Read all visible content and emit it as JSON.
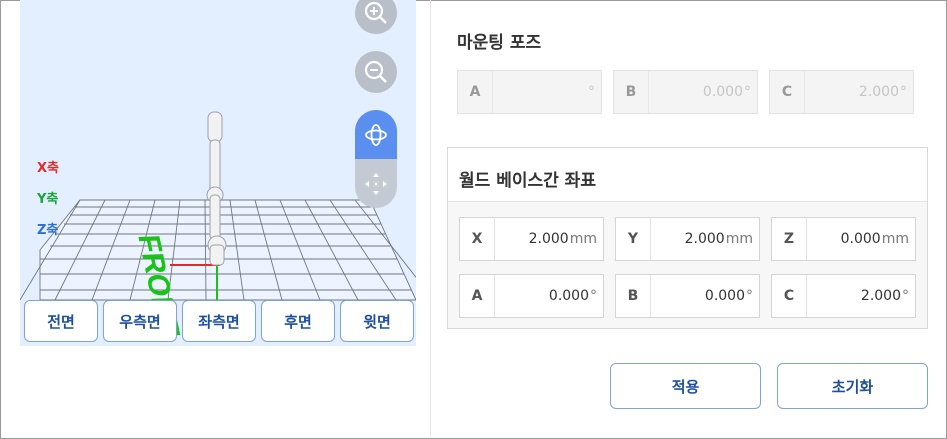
{
  "viewport": {
    "axis_labels": {
      "x": "X축",
      "y": "Y축",
      "z": "Z축"
    },
    "floor_label": "FRONT",
    "zoom_in_icon": "zoom-in-icon",
    "zoom_out_icon": "zoom-out-icon",
    "rotate_icon": "rotate-3d-icon",
    "move_icon": "move-arrows-icon",
    "view_buttons": [
      "전면",
      "우측면",
      "좌측면",
      "후면",
      "윗면"
    ]
  },
  "mounting_pose": {
    "title": "마운팅 포즈",
    "fields": [
      {
        "label": "A",
        "value": "",
        "unit": "°"
      },
      {
        "label": "B",
        "value": "0.000",
        "unit": "°"
      },
      {
        "label": "C",
        "value": "2.000",
        "unit": "°"
      }
    ]
  },
  "world_base": {
    "title": "월드 베이스간 좌표",
    "row1": [
      {
        "label": "X",
        "value": "2.000",
        "unit": "mm"
      },
      {
        "label": "Y",
        "value": "2.000",
        "unit": "mm"
      },
      {
        "label": "Z",
        "value": "0.000",
        "unit": "mm"
      }
    ],
    "row2": [
      {
        "label": "A",
        "value": "0.000",
        "unit": "°"
      },
      {
        "label": "B",
        "value": "0.000",
        "unit": "°"
      },
      {
        "label": "C",
        "value": "2.000",
        "unit": "°"
      }
    ]
  },
  "actions": {
    "apply": "적용",
    "reset": "초기화"
  },
  "colors": {
    "accent": "#1e4fa0",
    "active_mode": "#5a8ff0",
    "floor_text": "#18c418",
    "axis_x": "#e12b2b",
    "axis_y": "#1aa33a",
    "axis_z": "#2e6fd8"
  }
}
